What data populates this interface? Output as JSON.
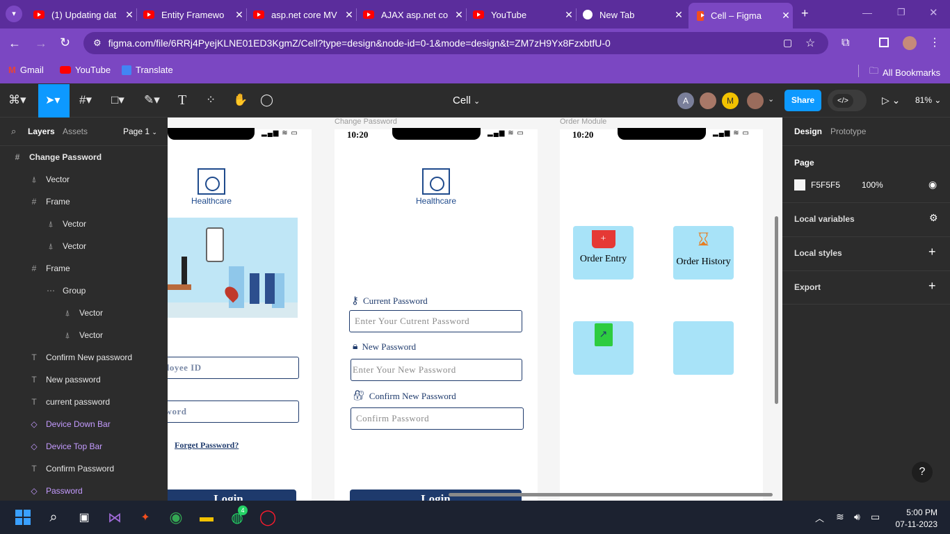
{
  "browser": {
    "tabs": [
      {
        "title": "(1) Updating dat"
      },
      {
        "title": "Entity Framewo"
      },
      {
        "title": "asp.net core MV"
      },
      {
        "title": "AJAX asp.net co"
      },
      {
        "title": "YouTube"
      },
      {
        "title": "New Tab"
      },
      {
        "title": "Cell – Figma"
      }
    ],
    "url": "figma.com/file/6RRj4PyejKLNE01ED3KgmZ/Cell?type=design&node-id=0-1&mode=design&t=ZM7zH9Yx8FzxbtfU-0",
    "bookmarks": [
      "Gmail",
      "YouTube",
      "Translate"
    ],
    "all_bookmarks": "All Bookmarks"
  },
  "figma": {
    "file_name": "Cell",
    "share_label": "Share",
    "zoom": "81%",
    "avatars": [
      "A",
      "M"
    ],
    "left_tabs": {
      "layers": "Layers",
      "assets": "Assets",
      "page": "Page 1"
    },
    "layers": [
      {
        "name": "Change Password",
        "icon": "frame-icon",
        "kind": "frame",
        "indent": 0
      },
      {
        "name": "Vector",
        "icon": "vector-icon",
        "kind": "plain",
        "indent": 1
      },
      {
        "name": "Frame",
        "icon": "frame-icon",
        "kind": "plain",
        "indent": 1
      },
      {
        "name": "Vector",
        "icon": "vector-icon",
        "kind": "plain",
        "indent": 2
      },
      {
        "name": "Vector",
        "icon": "vector-icon",
        "kind": "plain",
        "indent": 2
      },
      {
        "name": "Frame",
        "icon": "frame-icon",
        "kind": "plain",
        "indent": 1
      },
      {
        "name": "Group",
        "icon": "group-icon",
        "kind": "plain",
        "indent": 2
      },
      {
        "name": "Vector",
        "icon": "vector-icon",
        "kind": "plain",
        "indent": 3
      },
      {
        "name": "Vector",
        "icon": "vector-icon",
        "kind": "plain",
        "indent": 3
      },
      {
        "name": "Confirm New password",
        "icon": "text-icon",
        "kind": "plain",
        "indent": 1
      },
      {
        "name": "New password",
        "icon": "text-icon",
        "kind": "plain",
        "indent": 1
      },
      {
        "name": "current password",
        "icon": "text-icon",
        "kind": "plain",
        "indent": 1
      },
      {
        "name": "Device Down Bar",
        "icon": "component-icon",
        "kind": "comp",
        "indent": 1
      },
      {
        "name": "Device Top Bar",
        "icon": "component-icon",
        "kind": "comp",
        "indent": 1
      },
      {
        "name": "Confirm Password",
        "icon": "text-icon",
        "kind": "plain",
        "indent": 1
      },
      {
        "name": "Password",
        "icon": "component-icon",
        "kind": "comp",
        "indent": 1
      }
    ],
    "right_tabs": {
      "design": "Design",
      "prototype": "Prototype"
    },
    "page_section": {
      "title": "Page",
      "color": "F5F5F5",
      "opacity": "100%"
    },
    "sections": [
      "Local variables",
      "Local styles",
      "Export"
    ],
    "help": "?"
  },
  "canvas": {
    "frame_labels": [
      "Change Password",
      "Order Module"
    ],
    "status_time": "10:20",
    "logo_text": "Healthcare",
    "login_partial": {
      "employee_id": "ployee ID",
      "password": "sword",
      "forget": "Forget Password?",
      "login": "Login"
    },
    "change_password": {
      "current_label": "Current Password",
      "current_placeholder": "Enter Your Cutrent Password",
      "new_label": "New Password",
      "new_placeholder": "Enter Your New Password",
      "confirm_label": "Confirm New Password",
      "confirm_placeholder": "Confirm Password",
      "login": "Login"
    },
    "order_module": {
      "tiles": [
        "Order Entry",
        "Order History",
        "",
        ""
      ]
    }
  },
  "taskbar": {
    "time": "5:00 PM",
    "date": "07-11-2023",
    "whatsapp_badge": "4"
  }
}
